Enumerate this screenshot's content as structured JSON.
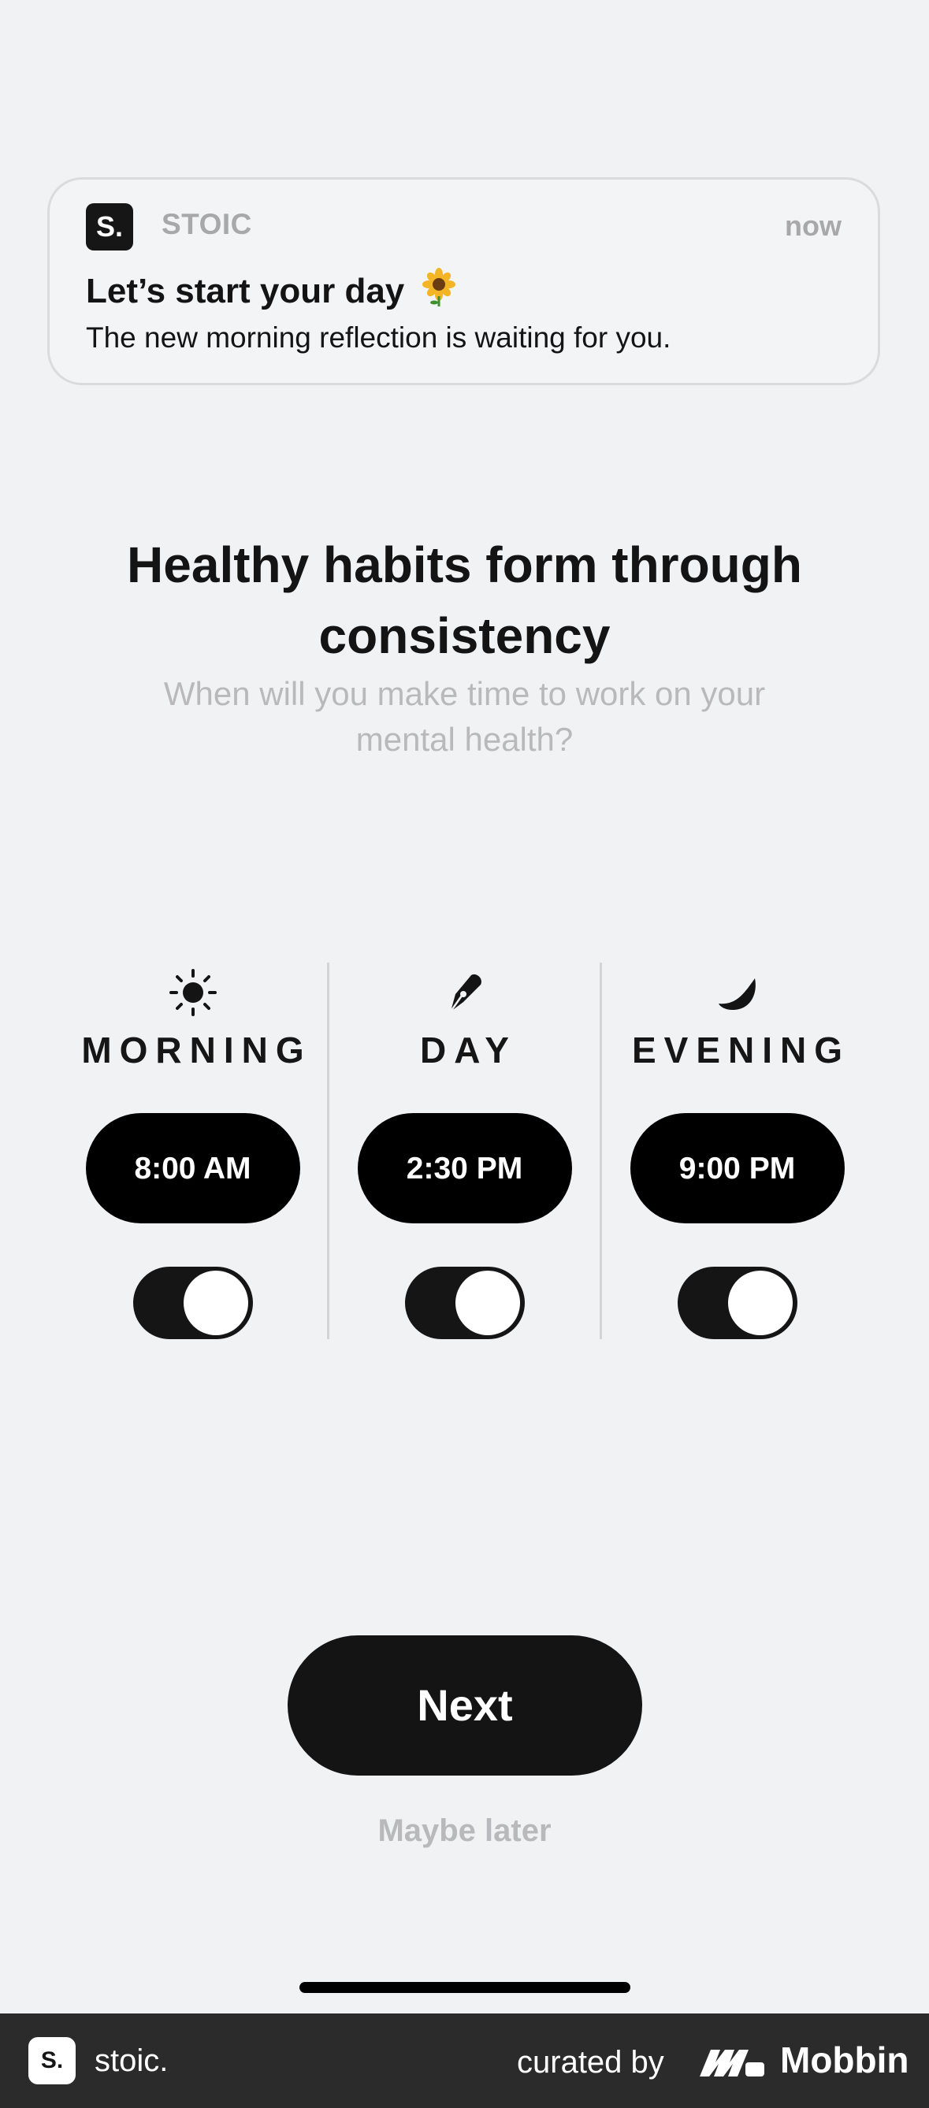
{
  "notification": {
    "logo_text": "S.",
    "app_name": "STOIC",
    "time": "now",
    "title": "Let’s start your day",
    "title_emoji_icon": "sunflower-icon",
    "body": "The new morning reflection is waiting for you."
  },
  "headline": "Healthy habits form through consistency",
  "subheadline": "When will you make time to work on your mental health?",
  "periods": [
    {
      "label": "MORNING",
      "icon": "sun-icon",
      "time": "8:00 AM",
      "enabled": true
    },
    {
      "label": "DAY",
      "icon": "pen-nib-icon",
      "time": "2:30 PM",
      "enabled": true
    },
    {
      "label": "EVENING",
      "icon": "moon-icon",
      "time": "9:00 PM",
      "enabled": true
    }
  ],
  "actions": {
    "next_label": "Next",
    "later_label": "Maybe later"
  },
  "footer": {
    "logo_text": "S.",
    "app_name": "stoic.",
    "curated_label": "curated by",
    "brand": "Mobbin"
  },
  "colors": {
    "background": "#f1f2f4",
    "primary": "#141414",
    "muted": "#b9b9bb",
    "footer": "#2b2b2b"
  }
}
